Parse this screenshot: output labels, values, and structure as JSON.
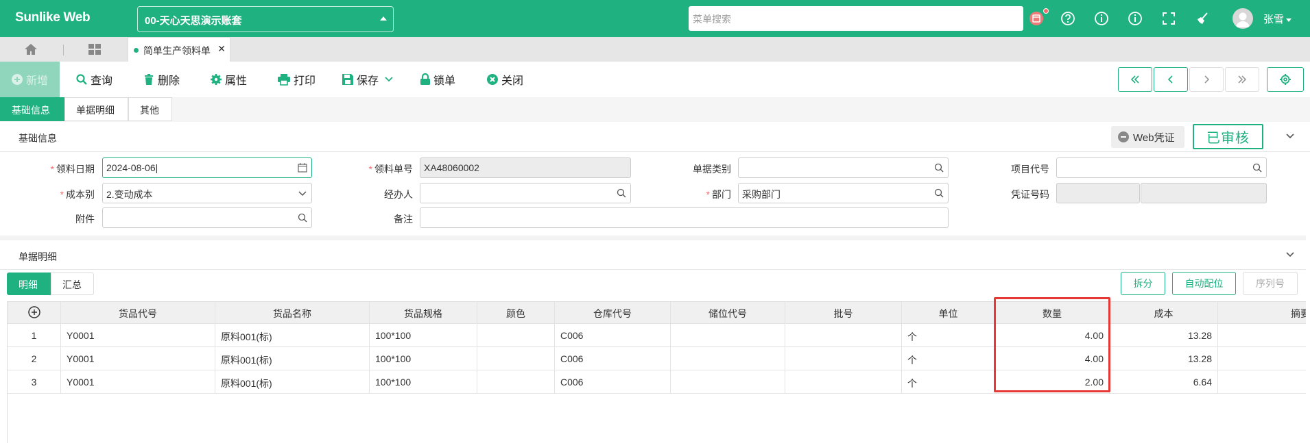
{
  "header": {
    "logo": "Sunlike Web",
    "account": "00-天心天思演示账套",
    "search_placeholder": "菜单搜索",
    "user": "张雪",
    "brand_color": "#1fb180"
  },
  "tabs": {
    "page_tab": "简单生产领料单"
  },
  "toolbar": {
    "new": "新增",
    "query": "查询",
    "delete": "删除",
    "props": "属性",
    "print": "打印",
    "save": "保存",
    "lock": "锁单",
    "close": "关闭"
  },
  "form_tabs": [
    "基础信息",
    "单据明细",
    "其他"
  ],
  "section1": {
    "title": "基础信息",
    "web_voucher": "Web凭证",
    "status": "已审核"
  },
  "form": {
    "date_label": "领料日期",
    "date_value": "2024-08-06",
    "no_label": "领料单号",
    "no_value": "XA48060002",
    "doctype_label": "单据类别",
    "doctype_value": "",
    "project_label": "项目代号",
    "project_value": "",
    "cost_label": "成本别",
    "cost_value": "2.变动成本",
    "handler_label": "经办人",
    "handler_value": "",
    "dept_label": "部门",
    "dept_value": "采购部门",
    "voucher_label": "凭证号码",
    "attach_label": "附件",
    "attach_value": "",
    "remark_label": "备注",
    "remark_value": ""
  },
  "section2": {
    "title": "单据明细"
  },
  "sub_tabs": [
    "明细",
    "汇总"
  ],
  "grid_buttons": {
    "split": "拆分",
    "auto": "自动配位",
    "serial": "序列号"
  },
  "grid": {
    "columns": [
      "货品代号",
      "货品名称",
      "货品规格",
      "颜色",
      "仓库代号",
      "储位代号",
      "批号",
      "单位",
      "数量",
      "成本",
      "摘要"
    ],
    "rows": [
      {
        "no": "1",
        "code": "Y0001",
        "name": "原料001(标)",
        "spec": "100*100",
        "color": "",
        "wh": "C006",
        "loc": "",
        "lot": "",
        "unit": "个",
        "qty": "4.00",
        "cost": "13.28"
      },
      {
        "no": "2",
        "code": "Y0001",
        "name": "原料001(标)",
        "spec": "100*100",
        "color": "",
        "wh": "C006",
        "loc": "",
        "lot": "",
        "unit": "个",
        "qty": "4.00",
        "cost": "13.28"
      },
      {
        "no": "3",
        "code": "Y0001",
        "name": "原料001(标)",
        "spec": "100*100",
        "color": "",
        "wh": "C006",
        "loc": "",
        "lot": "",
        "unit": "个",
        "qty": "2.00",
        "cost": "6.64"
      }
    ]
  }
}
